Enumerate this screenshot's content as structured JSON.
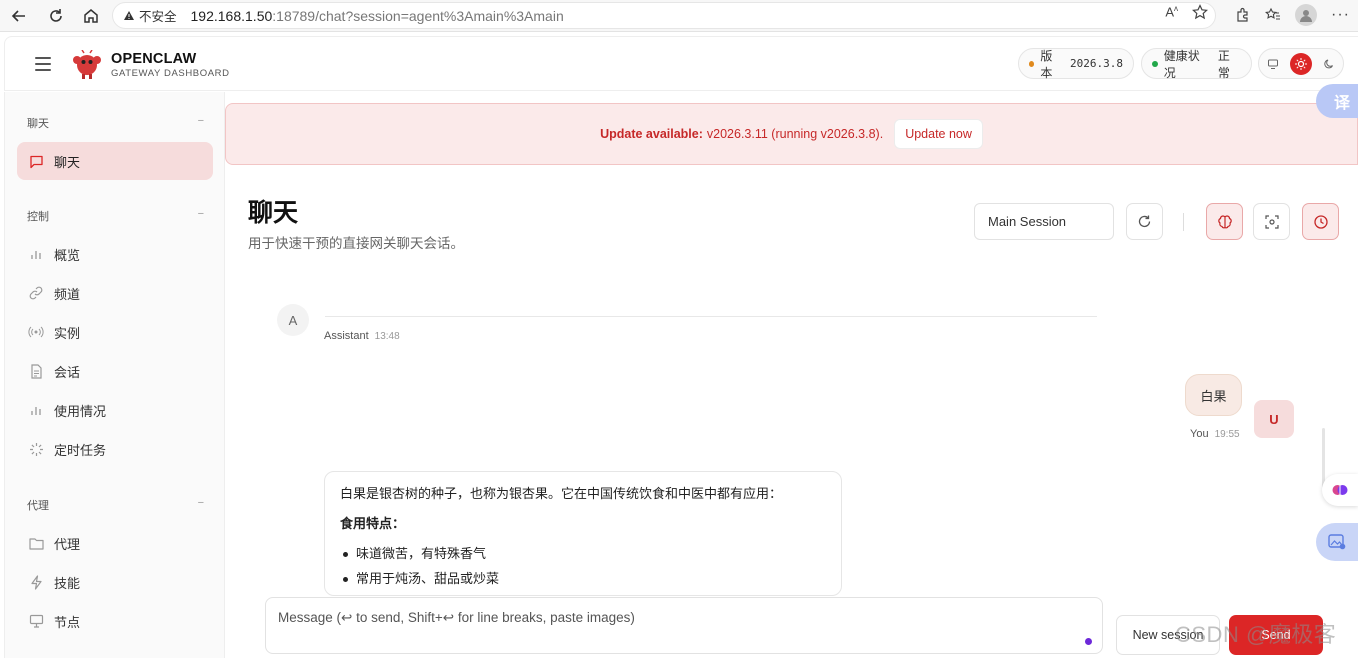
{
  "browser": {
    "security_label": "不安全",
    "url_host": "192.168.1.50",
    "url_rest": ":18789/chat?session=agent%3Amain%3Amain"
  },
  "header": {
    "brand_name": "OPENCLAW",
    "brand_sub": "GATEWAY DASHBOARD",
    "version_label": "版本",
    "version_value": "2026.3.8",
    "health_label": "健康状况",
    "health_value": "正常"
  },
  "sidebar": {
    "groups": [
      {
        "title": "聊天",
        "toggle": "−",
        "items": [
          {
            "label": "聊天",
            "icon": "message-square-icon",
            "active": true
          }
        ]
      },
      {
        "title": "控制",
        "toggle": "−",
        "items": [
          {
            "label": "概览",
            "icon": "bar-chart-icon"
          },
          {
            "label": "频道",
            "icon": "link-icon"
          },
          {
            "label": "实例",
            "icon": "radio-icon"
          },
          {
            "label": "会话",
            "icon": "file-text-icon"
          },
          {
            "label": "使用情况",
            "icon": "bar-chart-icon"
          },
          {
            "label": "定时任务",
            "icon": "loader-icon"
          }
        ]
      },
      {
        "title": "代理",
        "toggle": "−",
        "items": [
          {
            "label": "代理",
            "icon": "folder-icon"
          },
          {
            "label": "技能",
            "icon": "zap-icon"
          },
          {
            "label": "节点",
            "icon": "monitor-icon"
          }
        ]
      }
    ]
  },
  "banner": {
    "prefix": "Update available:",
    "message": "v2026.3.11 (running v2026.3.8).",
    "button": "Update now"
  },
  "page": {
    "title": "聊天",
    "subtitle": "用于快速干预的直接网关聊天会话。",
    "session_select": "Main Session"
  },
  "chat": {
    "assistant_avatar": "A",
    "assistant_name": "Assistant",
    "assistant_time1": "13:48",
    "user_message": "白果",
    "user_avatar": "U",
    "user_name": "You",
    "user_time": "19:55",
    "reply_intro": "白果是银杏树的种子，也称为银杏果。它在中国传统饮食和中医中都有应用：",
    "reply_heading": "食用特点：",
    "reply_bullets": [
      "味道微苦，有特殊香气",
      "常用于炖汤、甜品或炒菜"
    ]
  },
  "composer": {
    "placeholder": "Message (↩ to send, Shift+↩ for line breaks, paste images)",
    "new_session": "New session",
    "send": "Send"
  },
  "floating": {
    "translate_label": "译",
    "watermark": "CSDN @魔极客"
  },
  "colors": {
    "accent": "#dc2626",
    "banner_bg": "#fbeaea",
    "version_dot": "#e08a1e",
    "health_dot": "#22a84a"
  }
}
